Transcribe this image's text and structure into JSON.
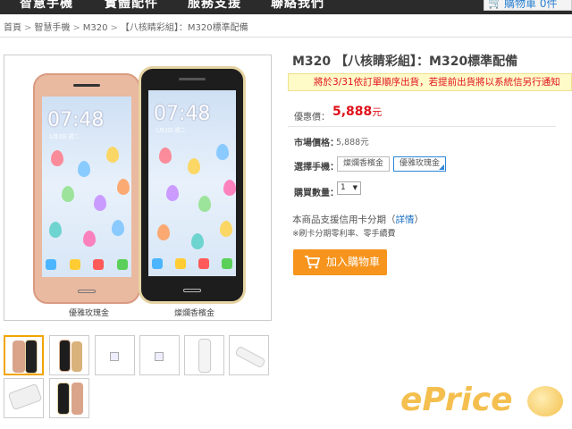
{
  "topnav": {
    "items": [
      "智慧手機",
      "實體配件",
      "服務支援",
      "聯絡我們"
    ],
    "cart_label": "購物車",
    "cart_count": "0件"
  },
  "breadcrumb": [
    "首頁",
    "智慧手機",
    "M320",
    "【八核睛彩組】：M320標準配備"
  ],
  "breadcrumb_sep": ">",
  "product": {
    "title": "M320 【八核睛彩組】：M320標準配備",
    "notice": "將於3/31依訂單順序出貨，若提前出貨將以系統信另行通知",
    "price_label": "優惠價：",
    "price_value": "5,888",
    "price_unit": "元",
    "market_label": "市場價格：",
    "market_value": "5,888元",
    "select_label": "選擇手機：",
    "options": [
      "燦爛香檳金",
      "優雅玫瑰金"
    ],
    "selected_option": "優雅玫瑰金",
    "qty_label": "購買數量：",
    "qty_value": "1",
    "installment_text": "本商品支援信用卡分期（",
    "installment_link": "詳情",
    "installment_end": "）",
    "installment_note": "※刷卡分期零利率、零手續費",
    "add_to_cart": "加入購物車"
  },
  "gallery": {
    "clock": "07:48",
    "date": "1月3日 週二",
    "captions": [
      "優雅玫瑰金",
      "燦爛香檳金"
    ]
  },
  "watermark": "ePrice",
  "colors": {
    "nav_bg": "#2b2b2b",
    "price": "#e0101a",
    "button": "#f7941d",
    "link": "#1a6fc4",
    "notice_bg": "#fffbc8"
  }
}
